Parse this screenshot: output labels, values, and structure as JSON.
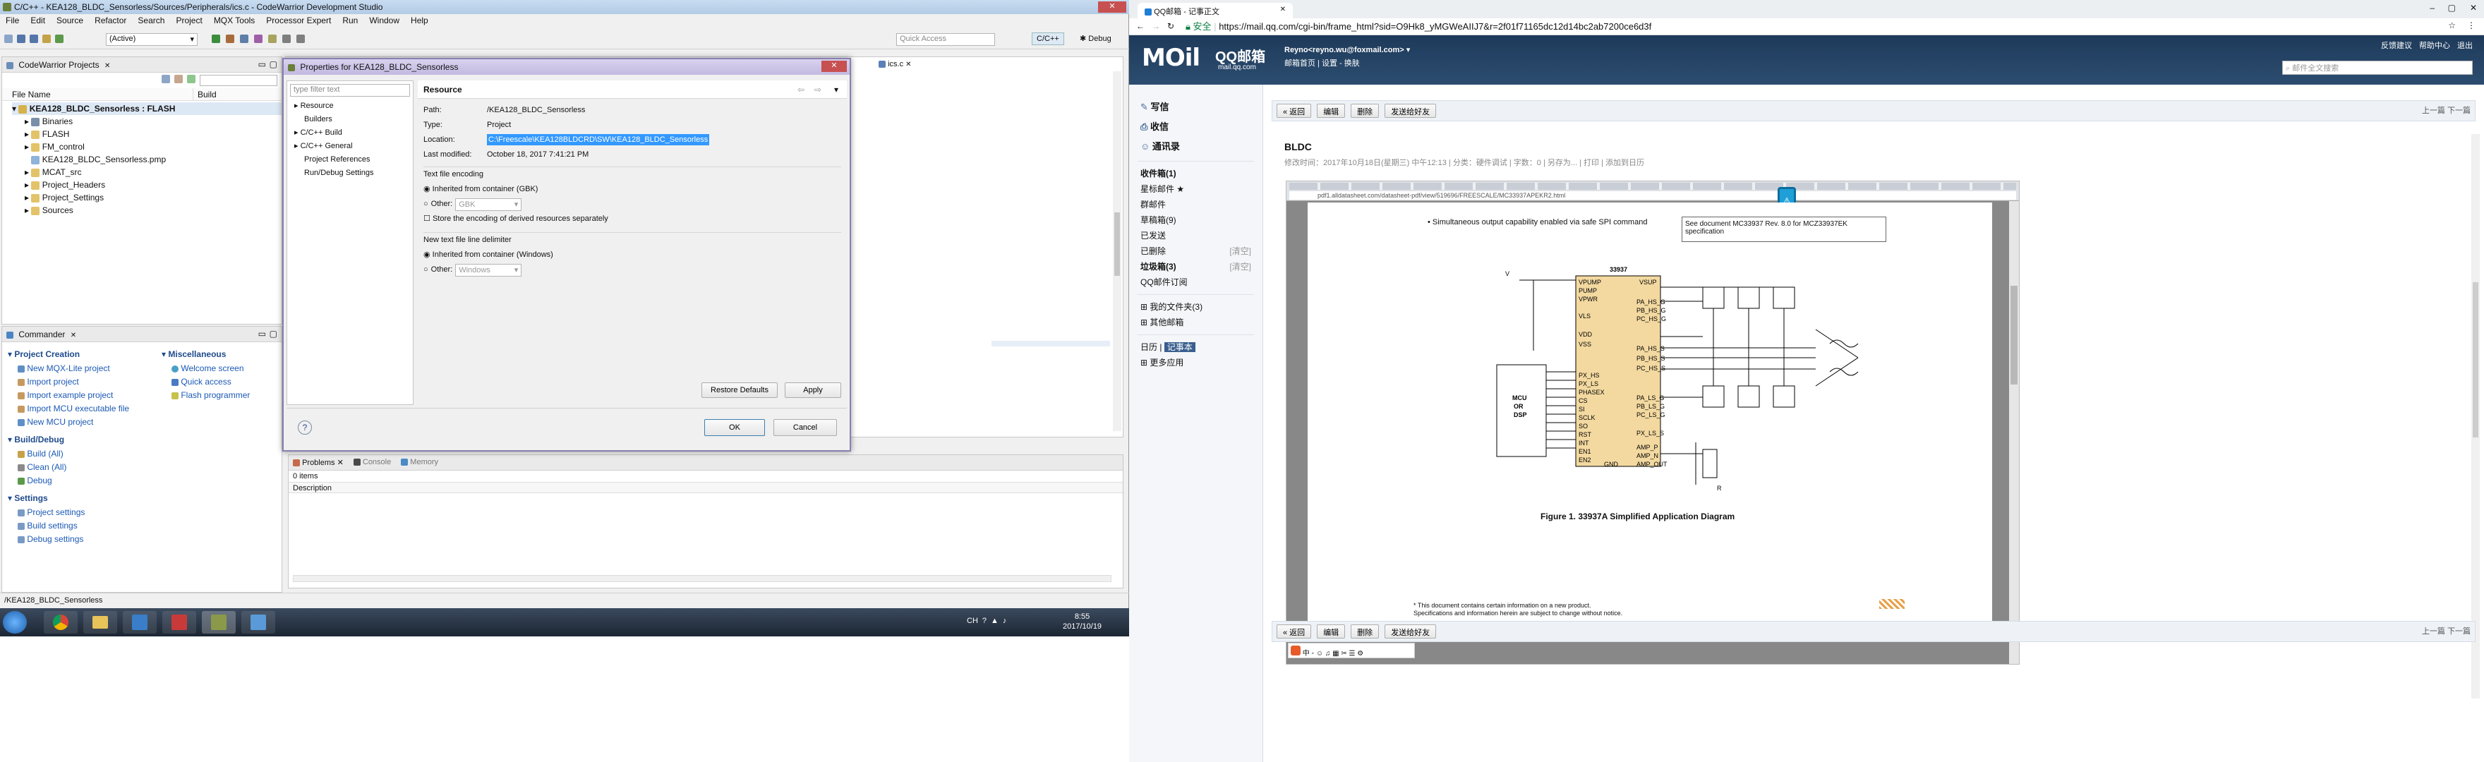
{
  "ide": {
    "title": "C/C++ - KEA128_BLDC_Sensorless/Sources/Peripherals/ics.c - CodeWarrior Development Studio",
    "menu": [
      "File",
      "Edit",
      "Source",
      "Refactor",
      "Search",
      "Project",
      "MQX Tools",
      "Processor Expert",
      "Run",
      "Window",
      "Help"
    ],
    "toolbar_combo": "(Active)",
    "quick_access_placeholder": "Quick Access",
    "persp_cpp": "C/C++",
    "persp_debug": "Debug",
    "projects_title": "CodeWarrior Projects",
    "col_file": "File Name",
    "col_build": "Build",
    "project_name": "KEA128_BLDC_Sensorless : FLASH",
    "tree": [
      "Binaries",
      "FLASH",
      "FM_control",
      "KEA128_BLDC_Sensorless.pmp",
      "MCAT_src",
      "Project_Headers",
      "Project_Settings",
      "Sources"
    ],
    "editor_tab": "ics.c",
    "commander": {
      "title": "Commander",
      "project_creation": "Project Creation",
      "pc_items": [
        "New MQX-Lite project",
        "Import project",
        "Import example project",
        "Import MCU executable file",
        "New MCU project"
      ],
      "misc": "Miscellaneous",
      "misc_items": [
        "Welcome screen",
        "Quick access",
        "Flash programmer"
      ],
      "build_debug": "Build/Debug",
      "bd_items": [
        "Build  (All)",
        "Clean  (All)",
        "Debug"
      ],
      "settings": "Settings",
      "settings_items": [
        "Project settings",
        "Build settings",
        "Debug settings"
      ]
    },
    "problems": {
      "tabs": [
        "Problems",
        "Console",
        "Memory"
      ],
      "count": "0 items",
      "col": "Description"
    },
    "statusbar": "/KEA128_BLDC_Sensorless"
  },
  "dialog": {
    "title": "Properties for KEA128_BLDC_Sensorless",
    "filter_placeholder": "type filter text",
    "nav": [
      "Resource",
      "Builders",
      "C/C++ Build",
      "C/C++ General",
      "Project References",
      "Run/Debug Settings"
    ],
    "heading": "Resource",
    "path_label": "Path:",
    "path": "/KEA128_BLDC_Sensorless",
    "type_label": "Type:",
    "type": "Project",
    "location_label": "Location:",
    "location": "C:\\Freescale\\KEA128BLDCRD\\SW\\KEA128_BLDC_Sensorless",
    "modified_label": "Last modified:",
    "modified": "October 18, 2017 7:41:21 PM",
    "encoding_title": "Text file encoding",
    "enc_inherited": "Inherited from container (GBK)",
    "enc_other": "Other:",
    "enc_other_value": "GBK",
    "store_encoding": "Store the encoding of derived resources separately",
    "delim_title": "New text file line delimiter",
    "delim_inherited": "Inherited from container (Windows)",
    "delim_other": "Other:",
    "delim_other_value": "Windows",
    "restore_defaults": "Restore Defaults",
    "apply": "Apply",
    "ok": "OK",
    "cancel": "Cancel",
    "help": "?"
  },
  "taskbar": {
    "time": "8:55",
    "date": "2017/10/19",
    "lang": "CH"
  },
  "browser": {
    "tab_title": "QQ邮箱 - 记事正文",
    "secure": "安全",
    "url": "https://mail.qq.com/cgi-bin/frame_html?sid=O9Hk8_yMGWeAIIJ7&r=2f01f71165dc12d14bc2ab7200ce6d3f"
  },
  "mail": {
    "logo": "MOil",
    "logo_cn": "QQ邮箱",
    "logo_domain": "mail.qq.com",
    "user": "Reyno<reyno.wu@foxmail.com>",
    "links": "邮箱首页 | 设置 - 换肤",
    "top_links": [
      "反馈建议",
      "帮助中心",
      "退出"
    ],
    "search_placeholder": "邮件全文搜索",
    "write": "写信",
    "inbox": "收信",
    "contacts": "通讯录",
    "folders": [
      "收件箱(1)",
      "星标邮件 ★",
      "群邮件",
      "草稿箱(9)",
      "已发送",
      "已删除",
      "垃圾箱(3)",
      "QQ邮件订阅"
    ],
    "folder_clear_deleted": "[清空]",
    "folder_clear_spam": "[清空]",
    "my_folders": "我的文件夹(3)",
    "other": "其他邮箱",
    "calendar": "日历",
    "notes": "记事本",
    "more": "更多应用",
    "toolbar": [
      "« 返回",
      "编辑",
      "删除",
      "发送给好友"
    ],
    "prev_next": "上一篇  下一篇",
    "note_title": "BLDC",
    "note_meta": "修改时间：2017年10月18日(星期三) 中午12:13 | 分类：硬件调试 | 字数：0 | 另存为... | 打印 | 添加到日历",
    "pdf_url": "pdf1.alldatasheet.com/datasheet-pdf/view/519696/FREESCALE/MC33937APEKR2.html",
    "pdf_bullet1": "Simultaneous output capability enabled via safe SPI command",
    "pdf_note": "See document MC33937 Rev. 8.0 for MCZ33937EK specification",
    "chip": "33937",
    "mcu": "MCU\nOR\nDSP",
    "figure_caption": "Figure 1. 33937A Simplified Application Diagram",
    "pdf_footer1": "* This document contains certain information on a new product.",
    "pdf_footer2": "Specifications and information herein are subject to change without notice."
  }
}
